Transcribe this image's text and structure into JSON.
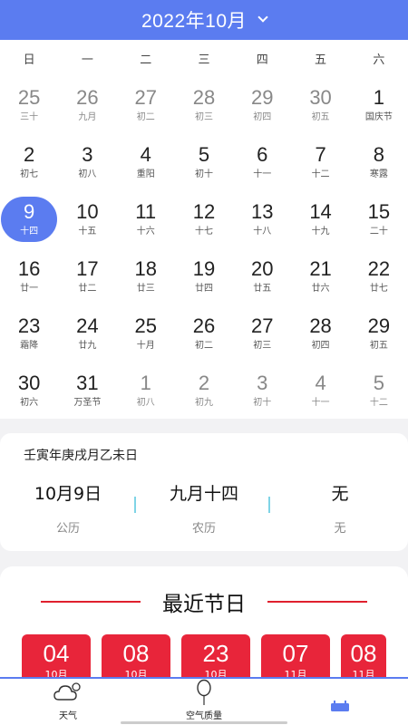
{
  "header": {
    "title": "2022年10月"
  },
  "weekdays": [
    "日",
    "一",
    "二",
    "三",
    "四",
    "五",
    "六"
  ],
  "days": [
    {
      "num": "25",
      "sub": "三十",
      "muted": true
    },
    {
      "num": "26",
      "sub": "九月",
      "muted": true
    },
    {
      "num": "27",
      "sub": "初二",
      "muted": true
    },
    {
      "num": "28",
      "sub": "初三",
      "muted": true
    },
    {
      "num": "29",
      "sub": "初四",
      "muted": true
    },
    {
      "num": "30",
      "sub": "初五",
      "muted": true
    },
    {
      "num": "1",
      "sub": "国庆节"
    },
    {
      "num": "2",
      "sub": "初七"
    },
    {
      "num": "3",
      "sub": "初八"
    },
    {
      "num": "4",
      "sub": "重阳"
    },
    {
      "num": "5",
      "sub": "初十"
    },
    {
      "num": "6",
      "sub": "十一"
    },
    {
      "num": "7",
      "sub": "十二"
    },
    {
      "num": "8",
      "sub": "寒露"
    },
    {
      "num": "9",
      "sub": "十四",
      "selected": true
    },
    {
      "num": "10",
      "sub": "十五"
    },
    {
      "num": "11",
      "sub": "十六"
    },
    {
      "num": "12",
      "sub": "十七"
    },
    {
      "num": "13",
      "sub": "十八"
    },
    {
      "num": "14",
      "sub": "十九"
    },
    {
      "num": "15",
      "sub": "二十"
    },
    {
      "num": "16",
      "sub": "廿一"
    },
    {
      "num": "17",
      "sub": "廿二"
    },
    {
      "num": "18",
      "sub": "廿三"
    },
    {
      "num": "19",
      "sub": "廿四"
    },
    {
      "num": "20",
      "sub": "廿五"
    },
    {
      "num": "21",
      "sub": "廿六"
    },
    {
      "num": "22",
      "sub": "廿七"
    },
    {
      "num": "23",
      "sub": "霜降"
    },
    {
      "num": "24",
      "sub": "廿九"
    },
    {
      "num": "25",
      "sub": "十月"
    },
    {
      "num": "26",
      "sub": "初二"
    },
    {
      "num": "27",
      "sub": "初三"
    },
    {
      "num": "28",
      "sub": "初四"
    },
    {
      "num": "29",
      "sub": "初五"
    },
    {
      "num": "30",
      "sub": "初六"
    },
    {
      "num": "31",
      "sub": "万圣节"
    },
    {
      "num": "1",
      "sub": "初八",
      "muted": true
    },
    {
      "num": "2",
      "sub": "初九",
      "muted": true
    },
    {
      "num": "3",
      "sub": "初十",
      "muted": true
    },
    {
      "num": "4",
      "sub": "十一",
      "muted": true
    },
    {
      "num": "5",
      "sub": "十二",
      "muted": true
    }
  ],
  "info": {
    "ganzhi": "壬寅年庚戌月乙未日",
    "solar": {
      "value": "10月9日",
      "label": "公历"
    },
    "lunar": {
      "value": "九月十四",
      "label": "农历"
    },
    "festival": {
      "value": "无",
      "label": "无"
    }
  },
  "festivals": {
    "title": "最近节日",
    "cards": [
      {
        "day": "04",
        "month": "10月"
      },
      {
        "day": "08",
        "month": "10月"
      },
      {
        "day": "23",
        "month": "10月"
      },
      {
        "day": "07",
        "month": "11月"
      },
      {
        "day": "08",
        "month": "11月"
      }
    ]
  },
  "tabs": [
    {
      "label": "天气",
      "icon": "weather-icon"
    },
    {
      "label": "空气质量",
      "icon": "balloon-icon"
    },
    {
      "label": "",
      "icon": "calendar-tab-icon"
    }
  ],
  "colors": {
    "accent": "#5b7cf0",
    "festival": "#e8253a"
  }
}
